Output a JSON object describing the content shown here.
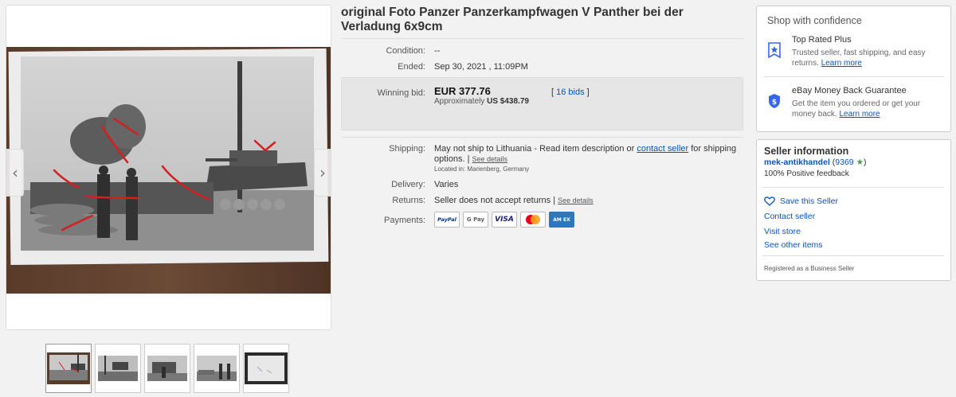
{
  "item": {
    "title": "original Foto Panzer Panzerkampfwagen V Panther bei der Verladung 6x9cm"
  },
  "details": {
    "condition_label": "Condition:",
    "condition_value": "--",
    "ended_label": "Ended:",
    "ended_value": "Sep 30, 2021 , 11:09PM",
    "winning_bid_label": "Winning bid:",
    "winning_bid_value": "EUR 377.76",
    "approx_prefix": "Approximately",
    "approx_value": "US $438.79",
    "bids_open": "[",
    "bids_link": "16 bids",
    "bids_close": "]",
    "shipping_label": "Shipping:",
    "shipping_text": "May not ship to Lithuania - Read item description or",
    "shipping_link": "contact seller",
    "shipping_text2": "for shipping options.",
    "shipping_sep": "|",
    "see_details": "See details",
    "located": "Located in:  Marienberg, Germany",
    "delivery_label": "Delivery:",
    "delivery_value": "Varies",
    "returns_label": "Returns:",
    "returns_value": "Seller does not accept returns",
    "returns_sep": "|",
    "returns_details": "See details",
    "payments_label": "Payments:",
    "payment_methods": [
      "PayPal",
      "G Pay",
      "VISA",
      "",
      "AM EX"
    ]
  },
  "confidence": {
    "title": "Shop with confidence",
    "top_rated_title": "Top Rated Plus",
    "top_rated_body": "Trusted seller, fast shipping, and easy returns.",
    "top_rated_link": "Learn more",
    "guarantee_title": "eBay Money Back Guarantee",
    "guarantee_body": "Get the item you ordered or get your money back.",
    "guarantee_link": "Learn more",
    "badge_icon": "star-badge-icon",
    "shield_icon": "shield-icon"
  },
  "seller": {
    "title": "Seller information",
    "name": "mek-antikhandel",
    "score_open": "(",
    "score": "9369",
    "score_close": ")",
    "star": "★",
    "feedback": "100% Positive feedback",
    "save_label": "Save this Seller",
    "contact_label": "Contact seller",
    "store_label": "Visit store",
    "other_label": "See other items",
    "business_note": "Registered as a Business Seller"
  },
  "gallery": {
    "prev_glyph": "‹",
    "next_glyph": "›",
    "thumbnail_count": 5
  },
  "colors": {
    "link": "#0654ba",
    "bid_box": "#e6e6e6",
    "star_green": "#43a047",
    "mastercard_red": "#eb001b",
    "mastercard_orange": "#f79e1b"
  }
}
